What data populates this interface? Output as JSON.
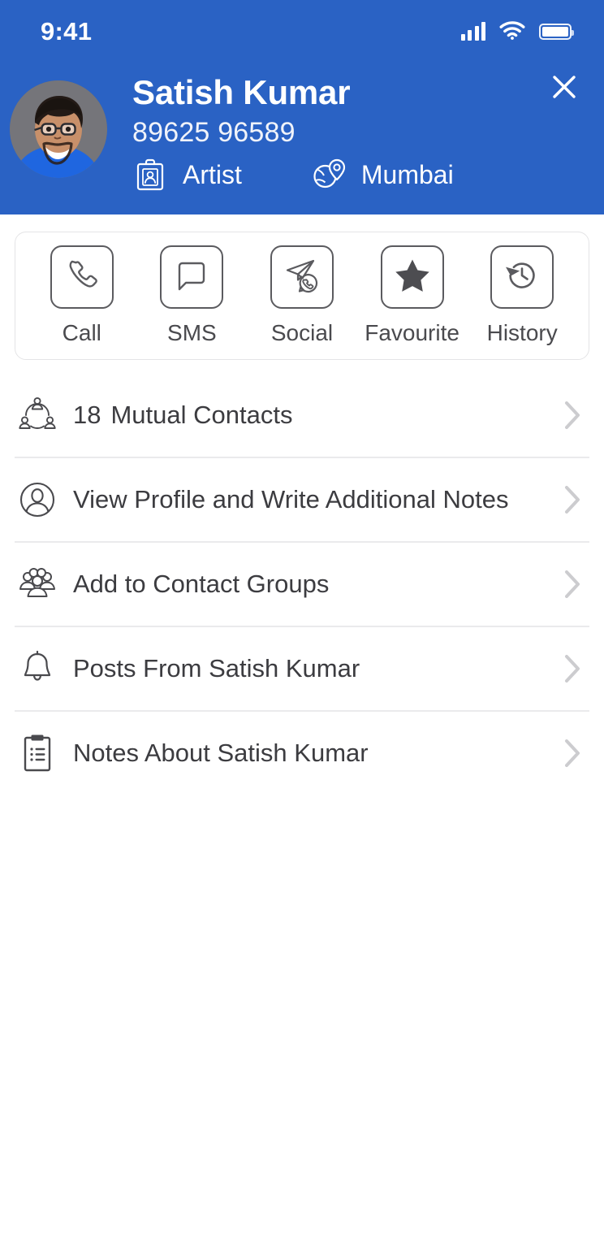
{
  "theme": {
    "header_blue": "#2a62c4",
    "icon_gray": "#5b5b5f",
    "text_gray": "#3c3c40",
    "chevron_gray": "#cccccf",
    "divider_gray": "#eaeaec",
    "card_border": "#e4e4e6"
  },
  "status_bar": {
    "time": "9:41",
    "cellular_icon": "cellular-signal-icon",
    "wifi_icon": "wifi-icon",
    "battery_icon": "battery-full-icon"
  },
  "header": {
    "avatar_alt": "Satish Kumar profile photo",
    "name": "Satish Kumar",
    "phone": "89625 96589",
    "meta": [
      {
        "icon": "briefcase-person-icon",
        "label": "Artist"
      },
      {
        "icon": "globe-location-pin-icon",
        "label": "Mumbai"
      }
    ],
    "close_icon": "close-icon",
    "close_label": "Close"
  },
  "actions": [
    {
      "icon": "phone-icon",
      "label": "Call"
    },
    {
      "icon": "message-bubble-icon",
      "label": "SMS"
    },
    {
      "icon": "paper-plane-chat-icon",
      "label": "Social"
    },
    {
      "icon": "star-filled-icon",
      "label": "Favourite"
    },
    {
      "icon": "clock-history-icon",
      "label": "History"
    }
  ],
  "list_rows": [
    {
      "icon": "mutual-contacts-network-icon",
      "count": "18",
      "label": "Mutual Contacts",
      "chevron": "chevron-right-icon"
    },
    {
      "icon": "person-circle-icon",
      "count": "",
      "label": "View Profile and Write Additional Notes",
      "chevron": "chevron-right-icon"
    },
    {
      "icon": "people-group-icon",
      "count": "",
      "label": "Add to Contact Groups",
      "chevron": "chevron-right-icon"
    },
    {
      "icon": "bell-icon",
      "count": "",
      "label": "Posts From Satish Kumar",
      "chevron": "chevron-right-icon"
    },
    {
      "icon": "clipboard-notes-icon",
      "count": "",
      "label": "Notes About Satish Kumar",
      "chevron": "chevron-right-icon"
    }
  ]
}
